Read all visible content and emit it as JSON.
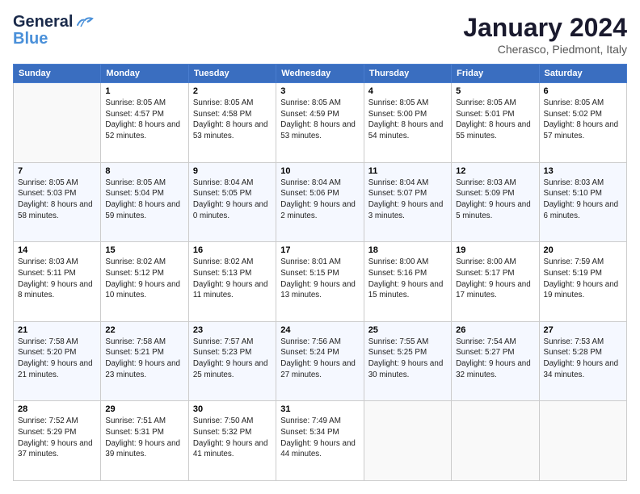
{
  "header": {
    "logo_general": "General",
    "logo_blue": "Blue",
    "month_title": "January 2024",
    "location": "Cherasco, Piedmont, Italy"
  },
  "weekdays": [
    "Sunday",
    "Monday",
    "Tuesday",
    "Wednesday",
    "Thursday",
    "Friday",
    "Saturday"
  ],
  "weeks": [
    [
      {
        "day": "",
        "sunrise": "",
        "sunset": "",
        "daylight": ""
      },
      {
        "day": "1",
        "sunrise": "Sunrise: 8:05 AM",
        "sunset": "Sunset: 4:57 PM",
        "daylight": "Daylight: 8 hours and 52 minutes."
      },
      {
        "day": "2",
        "sunrise": "Sunrise: 8:05 AM",
        "sunset": "Sunset: 4:58 PM",
        "daylight": "Daylight: 8 hours and 53 minutes."
      },
      {
        "day": "3",
        "sunrise": "Sunrise: 8:05 AM",
        "sunset": "Sunset: 4:59 PM",
        "daylight": "Daylight: 8 hours and 53 minutes."
      },
      {
        "day": "4",
        "sunrise": "Sunrise: 8:05 AM",
        "sunset": "Sunset: 5:00 PM",
        "daylight": "Daylight: 8 hours and 54 minutes."
      },
      {
        "day": "5",
        "sunrise": "Sunrise: 8:05 AM",
        "sunset": "Sunset: 5:01 PM",
        "daylight": "Daylight: 8 hours and 55 minutes."
      },
      {
        "day": "6",
        "sunrise": "Sunrise: 8:05 AM",
        "sunset": "Sunset: 5:02 PM",
        "daylight": "Daylight: 8 hours and 57 minutes."
      }
    ],
    [
      {
        "day": "7",
        "sunrise": "Sunrise: 8:05 AM",
        "sunset": "Sunset: 5:03 PM",
        "daylight": "Daylight: 8 hours and 58 minutes."
      },
      {
        "day": "8",
        "sunrise": "Sunrise: 8:05 AM",
        "sunset": "Sunset: 5:04 PM",
        "daylight": "Daylight: 8 hours and 59 minutes."
      },
      {
        "day": "9",
        "sunrise": "Sunrise: 8:04 AM",
        "sunset": "Sunset: 5:05 PM",
        "daylight": "Daylight: 9 hours and 0 minutes."
      },
      {
        "day": "10",
        "sunrise": "Sunrise: 8:04 AM",
        "sunset": "Sunset: 5:06 PM",
        "daylight": "Daylight: 9 hours and 2 minutes."
      },
      {
        "day": "11",
        "sunrise": "Sunrise: 8:04 AM",
        "sunset": "Sunset: 5:07 PM",
        "daylight": "Daylight: 9 hours and 3 minutes."
      },
      {
        "day": "12",
        "sunrise": "Sunrise: 8:03 AM",
        "sunset": "Sunset: 5:09 PM",
        "daylight": "Daylight: 9 hours and 5 minutes."
      },
      {
        "day": "13",
        "sunrise": "Sunrise: 8:03 AM",
        "sunset": "Sunset: 5:10 PM",
        "daylight": "Daylight: 9 hours and 6 minutes."
      }
    ],
    [
      {
        "day": "14",
        "sunrise": "Sunrise: 8:03 AM",
        "sunset": "Sunset: 5:11 PM",
        "daylight": "Daylight: 9 hours and 8 minutes."
      },
      {
        "day": "15",
        "sunrise": "Sunrise: 8:02 AM",
        "sunset": "Sunset: 5:12 PM",
        "daylight": "Daylight: 9 hours and 10 minutes."
      },
      {
        "day": "16",
        "sunrise": "Sunrise: 8:02 AM",
        "sunset": "Sunset: 5:13 PM",
        "daylight": "Daylight: 9 hours and 11 minutes."
      },
      {
        "day": "17",
        "sunrise": "Sunrise: 8:01 AM",
        "sunset": "Sunset: 5:15 PM",
        "daylight": "Daylight: 9 hours and 13 minutes."
      },
      {
        "day": "18",
        "sunrise": "Sunrise: 8:00 AM",
        "sunset": "Sunset: 5:16 PM",
        "daylight": "Daylight: 9 hours and 15 minutes."
      },
      {
        "day": "19",
        "sunrise": "Sunrise: 8:00 AM",
        "sunset": "Sunset: 5:17 PM",
        "daylight": "Daylight: 9 hours and 17 minutes."
      },
      {
        "day": "20",
        "sunrise": "Sunrise: 7:59 AM",
        "sunset": "Sunset: 5:19 PM",
        "daylight": "Daylight: 9 hours and 19 minutes."
      }
    ],
    [
      {
        "day": "21",
        "sunrise": "Sunrise: 7:58 AM",
        "sunset": "Sunset: 5:20 PM",
        "daylight": "Daylight: 9 hours and 21 minutes."
      },
      {
        "day": "22",
        "sunrise": "Sunrise: 7:58 AM",
        "sunset": "Sunset: 5:21 PM",
        "daylight": "Daylight: 9 hours and 23 minutes."
      },
      {
        "day": "23",
        "sunrise": "Sunrise: 7:57 AM",
        "sunset": "Sunset: 5:23 PM",
        "daylight": "Daylight: 9 hours and 25 minutes."
      },
      {
        "day": "24",
        "sunrise": "Sunrise: 7:56 AM",
        "sunset": "Sunset: 5:24 PM",
        "daylight": "Daylight: 9 hours and 27 minutes."
      },
      {
        "day": "25",
        "sunrise": "Sunrise: 7:55 AM",
        "sunset": "Sunset: 5:25 PM",
        "daylight": "Daylight: 9 hours and 30 minutes."
      },
      {
        "day": "26",
        "sunrise": "Sunrise: 7:54 AM",
        "sunset": "Sunset: 5:27 PM",
        "daylight": "Daylight: 9 hours and 32 minutes."
      },
      {
        "day": "27",
        "sunrise": "Sunrise: 7:53 AM",
        "sunset": "Sunset: 5:28 PM",
        "daylight": "Daylight: 9 hours and 34 minutes."
      }
    ],
    [
      {
        "day": "28",
        "sunrise": "Sunrise: 7:52 AM",
        "sunset": "Sunset: 5:29 PM",
        "daylight": "Daylight: 9 hours and 37 minutes."
      },
      {
        "day": "29",
        "sunrise": "Sunrise: 7:51 AM",
        "sunset": "Sunset: 5:31 PM",
        "daylight": "Daylight: 9 hours and 39 minutes."
      },
      {
        "day": "30",
        "sunrise": "Sunrise: 7:50 AM",
        "sunset": "Sunset: 5:32 PM",
        "daylight": "Daylight: 9 hours and 41 minutes."
      },
      {
        "day": "31",
        "sunrise": "Sunrise: 7:49 AM",
        "sunset": "Sunset: 5:34 PM",
        "daylight": "Daylight: 9 hours and 44 minutes."
      },
      {
        "day": "",
        "sunrise": "",
        "sunset": "",
        "daylight": ""
      },
      {
        "day": "",
        "sunrise": "",
        "sunset": "",
        "daylight": ""
      },
      {
        "day": "",
        "sunrise": "",
        "sunset": "",
        "daylight": ""
      }
    ]
  ]
}
